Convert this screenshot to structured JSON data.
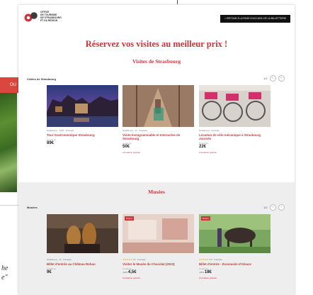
{
  "background": {
    "red_tab_text": "OU",
    "italic_lines": [
      "he",
      "e\""
    ]
  },
  "header": {
    "logo_lines": [
      "OFFICE",
      "DE TOURISME",
      "DE STRASBOURG",
      "ET SA RÉGION"
    ],
    "button_label": "< RETOUR À LA PAGE D'ACCUEIL DE LA BILLETTERIE"
  },
  "main_title": "Réservez vos visites au meilleur prix !",
  "sections": [
    {
      "title": "Visites de Strasbourg",
      "subtitle": "Visites de Strasbourg",
      "pager_count": "1/2",
      "cards": [
        {
          "meta": "Strasbourg · 1h30 · Français",
          "title": "Tour Gastronomique Strasbourg",
          "from_label": "À partir de",
          "price": "89€",
          "note": ""
        },
        {
          "meta": "Strasbourg · 1h · Français",
          "title": "Visite Instagrammable et Interactive de Strasbourg",
          "from_label": "À partir de",
          "price": "50€",
          "note": "Annulation gratuite"
        },
        {
          "meta": "Strasbourg · Français",
          "title": "Location de vélo mécanique à Strasbourg Journée",
          "from_label": "À partir de",
          "price": "22€",
          "note": "Annulation gratuite"
        }
      ]
    },
    {
      "title": "Musées",
      "subtitle": "Musées",
      "pager_count": "1/2",
      "cards": [
        {
          "badge": "",
          "meta": "Strasbourg · 1h · Français",
          "title": "Billet d'entrée au Château Rohan",
          "from_label": "À partir de",
          "price": "9€",
          "note": ""
        },
        {
          "badge": "Promo",
          "stars": "★★★★★",
          "meta": "4.6 · Français",
          "title": "Visiter le Musée du Chocolat (2023)",
          "from_label": "À partir de",
          "discount": "-10%",
          "price": "4,5€",
          "note": "Annulation gratuite"
        },
        {
          "badge": "Promo",
          "stars": "★★★★★",
          "meta": "4.8 · Français",
          "title": "Billet d'entrée - Écomusée d'Alsace",
          "from_label": "À partir de",
          "discount": "-15%",
          "price": "18€",
          "note": "Annulation gratuite"
        }
      ]
    }
  ]
}
